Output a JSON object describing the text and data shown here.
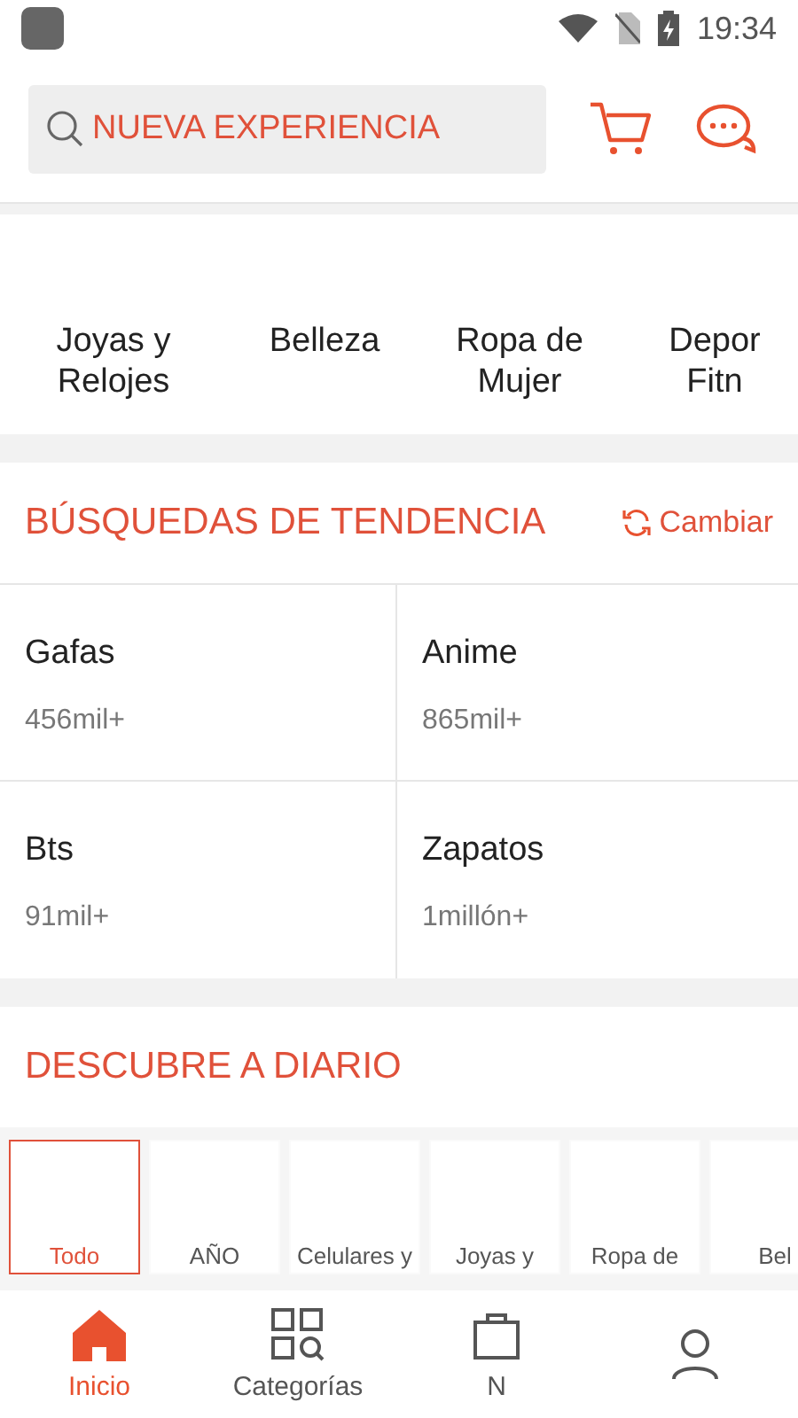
{
  "status_bar": {
    "time": "19:34"
  },
  "search": {
    "placeholder": "NUEVA EXPERIENCIA"
  },
  "categories": [
    "Joyas y\nRelojes",
    "Belleza",
    "Ropa de\nMujer",
    "Depor\nFitn"
  ],
  "trending": {
    "title": "BÚSQUEDAS DE TENDENCIA",
    "action": "Cambiar",
    "items": [
      {
        "term": "Gafas",
        "count": "456mil+"
      },
      {
        "term": "Anime",
        "count": "865mil+"
      },
      {
        "term": "Bts",
        "count": "91mil+"
      },
      {
        "term": "Zapatos",
        "count": "1millón+"
      }
    ]
  },
  "discover": {
    "title": "DESCUBRE A DIARIO",
    "tabs": [
      {
        "label": "Todo",
        "selected": true
      },
      {
        "label": "AÑO",
        "selected": false
      },
      {
        "label": "Celulares y",
        "selected": false
      },
      {
        "label": "Joyas y",
        "selected": false
      },
      {
        "label": "Ropa de",
        "selected": false
      },
      {
        "label": "Bel",
        "selected": false
      }
    ]
  },
  "bottom_nav": [
    {
      "kind": "home",
      "label": "Inicio",
      "selected": true
    },
    {
      "kind": "categories",
      "label": "Categorías",
      "selected": false
    },
    {
      "kind": "bag",
      "label": "N",
      "selected": false
    },
    {
      "kind": "person",
      "selected": false
    }
  ]
}
